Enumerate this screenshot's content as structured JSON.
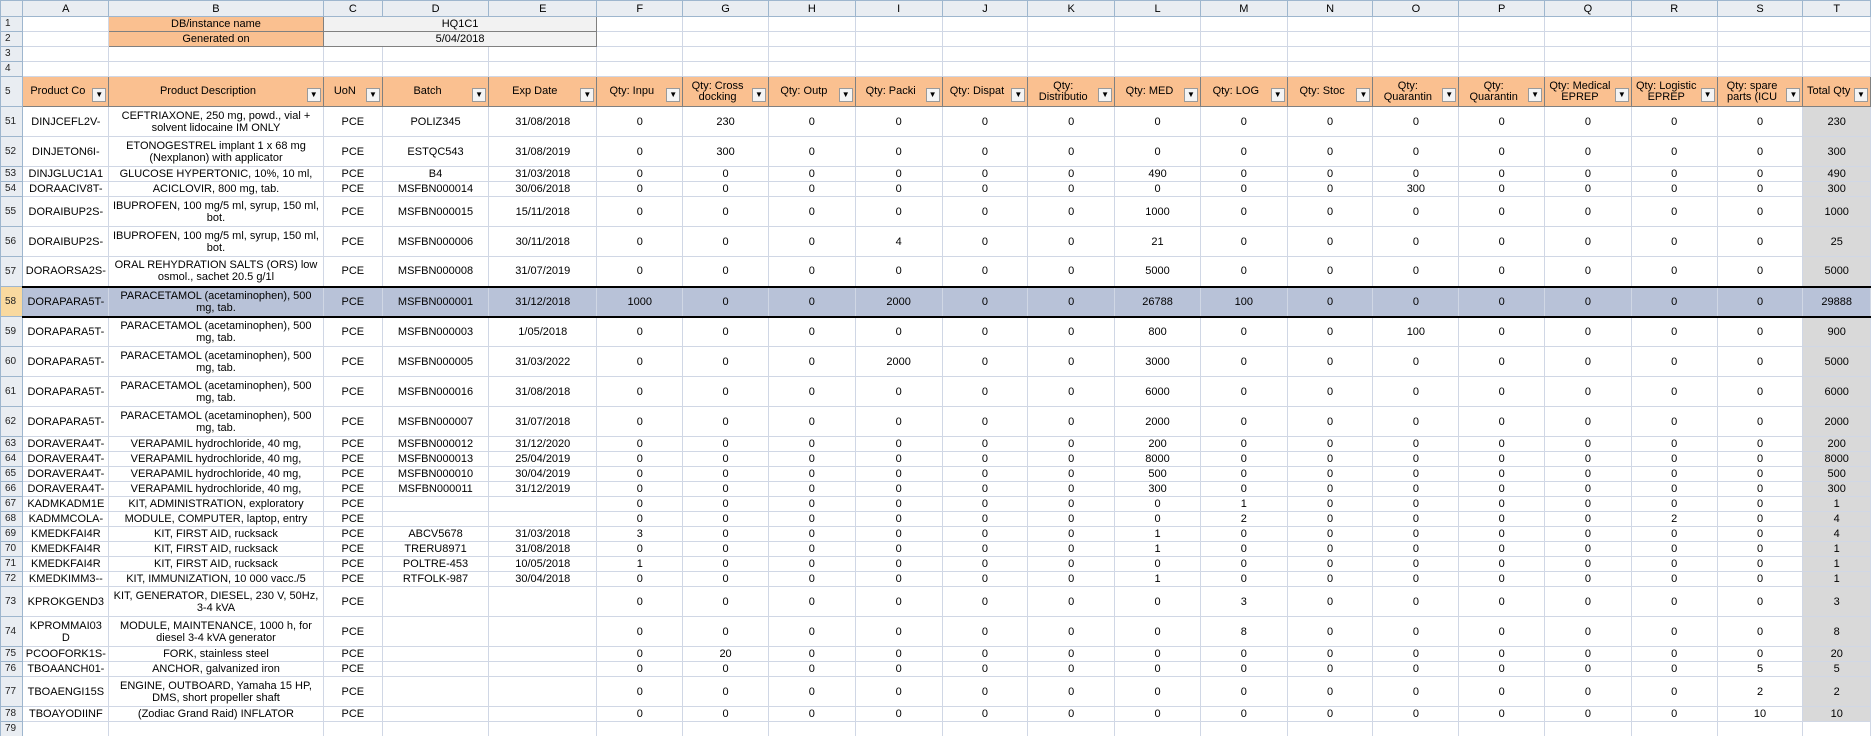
{
  "columns": [
    "A",
    "B",
    "C",
    "D",
    "E",
    "F",
    "G",
    "H",
    "I",
    "J",
    "K",
    "L",
    "M",
    "N",
    "O",
    "P",
    "Q",
    "R",
    "S",
    "T"
  ],
  "meta": {
    "db_label": "DB/instance name",
    "db_value": "HQ1C1",
    "gen_label": "Generated on",
    "gen_value": "5/04/2018"
  },
  "header_row_num": "5",
  "headers": [
    "Product Co",
    "Product Description",
    "UoN",
    "Batch",
    "Exp Date",
    "Qty: Inpu",
    "Qty: Cross docking",
    "Qty: Outp",
    "Qty: Packi",
    "Qty: Dispat",
    "Qty: Distributio",
    "Qty: MED",
    "Qty: LOG",
    "Qty: Stoc",
    "Qty: Quarantin",
    "Qty: Quarantin",
    "Qty: Medical EPREP",
    "Qty: Logistic EPREP",
    "Qty: spare parts (ICU",
    "Total Qty"
  ],
  "rows": [
    {
      "n": "51",
      "h": 30,
      "c": [
        "DINJCEFL2V-",
        "CEFTRIAXONE, 250 mg, powd., vial + solvent lidocaine IM ONLY",
        "PCE",
        "POLIZ345",
        "31/08/2018",
        "0",
        "230",
        "0",
        "0",
        "0",
        "0",
        "0",
        "0",
        "0",
        "0",
        "0",
        "0",
        "0",
        "0",
        "230"
      ]
    },
    {
      "n": "52",
      "h": 30,
      "c": [
        "DINJETON6I-",
        "ETONOGESTREL implant 1 x 68 mg (Nexplanon) with applicator",
        "PCE",
        "ESTQC543",
        "31/08/2019",
        "0",
        "300",
        "0",
        "0",
        "0",
        "0",
        "0",
        "0",
        "0",
        "0",
        "0",
        "0",
        "0",
        "0",
        "300"
      ]
    },
    {
      "n": "53",
      "h": 15,
      "c": [
        "DINJGLUC1A1",
        "GLUCOSE HYPERTONIC, 10%, 10 ml,",
        "PCE",
        "B4",
        "31/03/2018",
        "0",
        "0",
        "0",
        "0",
        "0",
        "0",
        "490",
        "0",
        "0",
        "0",
        "0",
        "0",
        "0",
        "0",
        "490"
      ]
    },
    {
      "n": "54",
      "h": 15,
      "c": [
        "DORAACIV8T-",
        "ACICLOVIR, 800 mg, tab.",
        "PCE",
        "MSFBN000014",
        "30/06/2018",
        "0",
        "0",
        "0",
        "0",
        "0",
        "0",
        "0",
        "0",
        "0",
        "300",
        "0",
        "0",
        "0",
        "0",
        "300"
      ]
    },
    {
      "n": "55",
      "h": 30,
      "c": [
        "DORAIBUP2S-",
        "IBUPROFEN, 100 mg/5 ml, syrup, 150 ml, bot.",
        "PCE",
        "MSFBN000015",
        "15/11/2018",
        "0",
        "0",
        "0",
        "0",
        "0",
        "0",
        "1000",
        "0",
        "0",
        "0",
        "0",
        "0",
        "0",
        "0",
        "1000"
      ]
    },
    {
      "n": "56",
      "h": 30,
      "c": [
        "DORAIBUP2S-",
        "IBUPROFEN, 100 mg/5 ml, syrup, 150 ml, bot.",
        "PCE",
        "MSFBN000006",
        "30/11/2018",
        "0",
        "0",
        "0",
        "4",
        "0",
        "0",
        "21",
        "0",
        "0",
        "0",
        "0",
        "0",
        "0",
        "0",
        "25"
      ]
    },
    {
      "n": "57",
      "h": 30,
      "c": [
        "DORAORSA2S-",
        "ORAL REHYDRATION SALTS (ORS) low osmol., sachet 20.5 g/1l",
        "PCE",
        "MSFBN000008",
        "31/07/2019",
        "0",
        "0",
        "0",
        "0",
        "0",
        "0",
        "5000",
        "0",
        "0",
        "0",
        "0",
        "0",
        "0",
        "0",
        "5000"
      ]
    },
    {
      "n": "58",
      "h": 30,
      "sel": true,
      "c": [
        "DORAPARA5T-",
        "PARACETAMOL (acetaminophen), 500 mg, tab.",
        "PCE",
        "MSFBN000001",
        "31/12/2018",
        "1000",
        "0",
        "0",
        "2000",
        "0",
        "0",
        "26788",
        "100",
        "0",
        "0",
        "0",
        "0",
        "0",
        "0",
        "29888"
      ]
    },
    {
      "n": "59",
      "h": 30,
      "c": [
        "DORAPARA5T-",
        "PARACETAMOL (acetaminophen), 500 mg, tab.",
        "PCE",
        "MSFBN000003",
        "1/05/2018",
        "0",
        "0",
        "0",
        "0",
        "0",
        "0",
        "800",
        "0",
        "0",
        "100",
        "0",
        "0",
        "0",
        "0",
        "900"
      ]
    },
    {
      "n": "60",
      "h": 30,
      "c": [
        "DORAPARA5T-",
        "PARACETAMOL (acetaminophen), 500 mg, tab.",
        "PCE",
        "MSFBN000005",
        "31/03/2022",
        "0",
        "0",
        "0",
        "2000",
        "0",
        "0",
        "3000",
        "0",
        "0",
        "0",
        "0",
        "0",
        "0",
        "0",
        "5000"
      ]
    },
    {
      "n": "61",
      "h": 30,
      "c": [
        "DORAPARA5T-",
        "PARACETAMOL (acetaminophen), 500 mg, tab.",
        "PCE",
        "MSFBN000016",
        "31/08/2018",
        "0",
        "0",
        "0",
        "0",
        "0",
        "0",
        "6000",
        "0",
        "0",
        "0",
        "0",
        "0",
        "0",
        "0",
        "6000"
      ]
    },
    {
      "n": "62",
      "h": 30,
      "c": [
        "DORAPARA5T-",
        "PARACETAMOL (acetaminophen), 500 mg, tab.",
        "PCE",
        "MSFBN000007",
        "31/07/2018",
        "0",
        "0",
        "0",
        "0",
        "0",
        "0",
        "2000",
        "0",
        "0",
        "0",
        "0",
        "0",
        "0",
        "0",
        "2000"
      ]
    },
    {
      "n": "63",
      "h": 15,
      "c": [
        "DORAVERA4T-",
        "VERAPAMIL hydrochloride, 40 mg,",
        "PCE",
        "MSFBN000012",
        "31/12/2020",
        "0",
        "0",
        "0",
        "0",
        "0",
        "0",
        "200",
        "0",
        "0",
        "0",
        "0",
        "0",
        "0",
        "0",
        "200"
      ]
    },
    {
      "n": "64",
      "h": 15,
      "c": [
        "DORAVERA4T-",
        "VERAPAMIL hydrochloride, 40 mg,",
        "PCE",
        "MSFBN000013",
        "25/04/2019",
        "0",
        "0",
        "0",
        "0",
        "0",
        "0",
        "8000",
        "0",
        "0",
        "0",
        "0",
        "0",
        "0",
        "0",
        "8000"
      ]
    },
    {
      "n": "65",
      "h": 15,
      "c": [
        "DORAVERA4T-",
        "VERAPAMIL hydrochloride, 40 mg,",
        "PCE",
        "MSFBN000010",
        "30/04/2019",
        "0",
        "0",
        "0",
        "0",
        "0",
        "0",
        "500",
        "0",
        "0",
        "0",
        "0",
        "0",
        "0",
        "0",
        "500"
      ]
    },
    {
      "n": "66",
      "h": 15,
      "c": [
        "DORAVERA4T-",
        "VERAPAMIL hydrochloride, 40 mg,",
        "PCE",
        "MSFBN000011",
        "31/12/2019",
        "0",
        "0",
        "0",
        "0",
        "0",
        "0",
        "300",
        "0",
        "0",
        "0",
        "0",
        "0",
        "0",
        "0",
        "300"
      ]
    },
    {
      "n": "67",
      "h": 15,
      "c": [
        "KADMKADM1E",
        "KIT, ADMINISTRATION, exploratory",
        "PCE",
        "",
        "",
        "0",
        "0",
        "0",
        "0",
        "0",
        "0",
        "0",
        "1",
        "0",
        "0",
        "0",
        "0",
        "0",
        "0",
        "1"
      ]
    },
    {
      "n": "68",
      "h": 15,
      "c": [
        "KADMMCOLA-",
        "MODULE, COMPUTER, laptop, entry",
        "PCE",
        "",
        "",
        "0",
        "0",
        "0",
        "0",
        "0",
        "0",
        "0",
        "2",
        "0",
        "0",
        "0",
        "0",
        "2",
        "0",
        "4"
      ]
    },
    {
      "n": "69",
      "h": 15,
      "c": [
        "KMEDKFAI4R",
        "KIT, FIRST AID, rucksack",
        "PCE",
        "ABCV5678",
        "31/03/2018",
        "3",
        "0",
        "0",
        "0",
        "0",
        "0",
        "1",
        "0",
        "0",
        "0",
        "0",
        "0",
        "0",
        "0",
        "4"
      ]
    },
    {
      "n": "70",
      "h": 15,
      "c": [
        "KMEDKFAI4R",
        "KIT, FIRST AID, rucksack",
        "PCE",
        "TRERU8971",
        "31/08/2018",
        "0",
        "0",
        "0",
        "0",
        "0",
        "0",
        "1",
        "0",
        "0",
        "0",
        "0",
        "0",
        "0",
        "0",
        "1"
      ]
    },
    {
      "n": "71",
      "h": 15,
      "c": [
        "KMEDKFAI4R",
        "KIT, FIRST AID, rucksack",
        "PCE",
        "POLTRE-453",
        "10/05/2018",
        "1",
        "0",
        "0",
        "0",
        "0",
        "0",
        "0",
        "0",
        "0",
        "0",
        "0",
        "0",
        "0",
        "0",
        "1"
      ]
    },
    {
      "n": "72",
      "h": 15,
      "c": [
        "KMEDKIMM3--",
        "KIT, IMMUNIZATION, 10 000 vacc./5",
        "PCE",
        "RTFOLK-987",
        "30/04/2018",
        "0",
        "0",
        "0",
        "0",
        "0",
        "0",
        "1",
        "0",
        "0",
        "0",
        "0",
        "0",
        "0",
        "0",
        "1"
      ]
    },
    {
      "n": "73",
      "h": 30,
      "c": [
        "KPROKGEND3",
        "KIT, GENERATOR, DIESEL, 230 V, 50Hz, 3-4 kVA",
        "PCE",
        "",
        "",
        "0",
        "0",
        "0",
        "0",
        "0",
        "0",
        "0",
        "3",
        "0",
        "0",
        "0",
        "0",
        "0",
        "0",
        "3"
      ]
    },
    {
      "n": "74",
      "h": 30,
      "c": [
        "KPROMMAI03 D",
        "MODULE, MAINTENANCE, 1000 h, for diesel 3-4 kVA generator",
        "PCE",
        "",
        "",
        "0",
        "0",
        "0",
        "0",
        "0",
        "0",
        "0",
        "8",
        "0",
        "0",
        "0",
        "0",
        "0",
        "0",
        "8"
      ]
    },
    {
      "n": "75",
      "h": 15,
      "c": [
        "PCOOFORK1S-",
        "FORK, stainless steel",
        "PCE",
        "",
        "",
        "0",
        "20",
        "0",
        "0",
        "0",
        "0",
        "0",
        "0",
        "0",
        "0",
        "0",
        "0",
        "0",
        "0",
        "20"
      ]
    },
    {
      "n": "76",
      "h": 15,
      "c": [
        "TBOAANCH01-",
        "ANCHOR, galvanized iron",
        "PCE",
        "",
        "",
        "0",
        "0",
        "0",
        "0",
        "0",
        "0",
        "0",
        "0",
        "0",
        "0",
        "0",
        "0",
        "0",
        "5",
        "5"
      ]
    },
    {
      "n": "77",
      "h": 30,
      "c": [
        "TBOAENGI15S",
        "ENGINE, OUTBOARD, Yamaha 15 HP, DMS, short propeller shaft",
        "PCE",
        "",
        "",
        "0",
        "0",
        "0",
        "0",
        "0",
        "0",
        "0",
        "0",
        "0",
        "0",
        "0",
        "0",
        "0",
        "2",
        "2"
      ]
    },
    {
      "n": "78",
      "h": 15,
      "c": [
        "TBOAYODIINF",
        "(Zodiac Grand Raid) INFLATOR",
        "PCE",
        "",
        "",
        "0",
        "0",
        "0",
        "0",
        "0",
        "0",
        "0",
        "0",
        "0",
        "0",
        "0",
        "0",
        "0",
        "10",
        "10"
      ]
    }
  ],
  "colors": {
    "header_fill": "#fac090",
    "total_fill": "#d9d9d9",
    "selected_row": "#b8c2d8",
    "grid": "#d0d7e5"
  }
}
